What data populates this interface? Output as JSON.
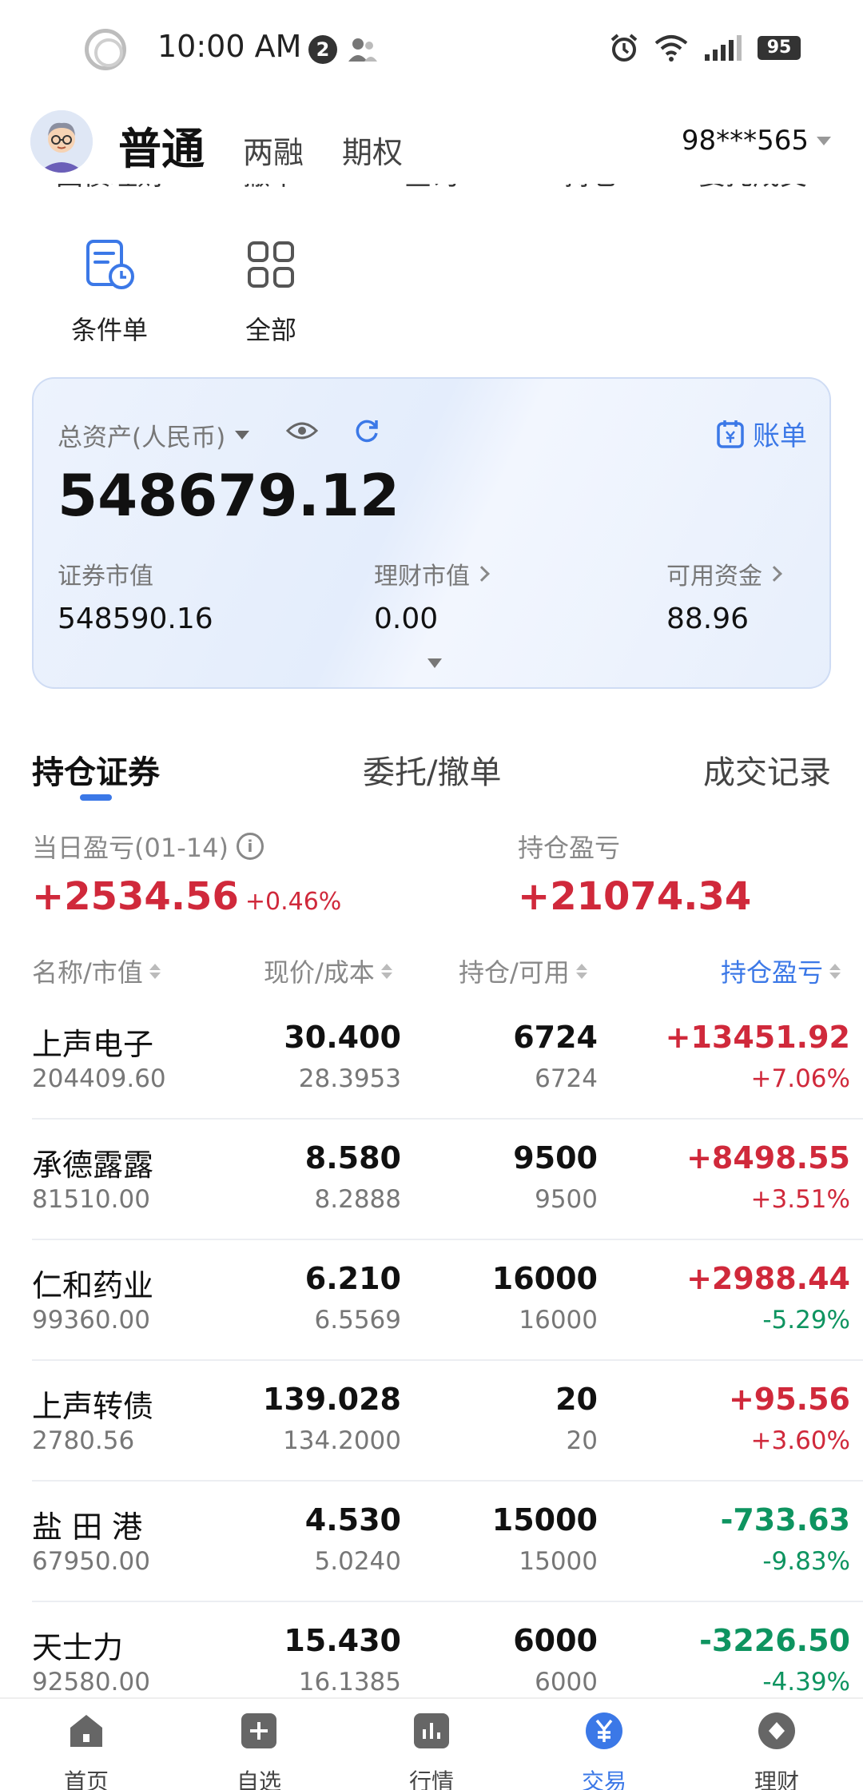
{
  "status_bar": {
    "time": "10:00 AM",
    "notification_count": "2",
    "battery": "95"
  },
  "header": {
    "account_tabs": [
      "普通",
      "两融",
      "期权"
    ],
    "account_id": "98***565"
  },
  "shortcuts_clipped": [
    "国债理财",
    "撤单",
    "查询",
    "持仓",
    "委托成交"
  ],
  "shortcuts": [
    {
      "label": "条件单",
      "icon": "conditional-order-icon"
    },
    {
      "label": "全部",
      "icon": "grid-icon"
    }
  ],
  "assets": {
    "title": "总资产(人民币)",
    "bill_label": "账单",
    "total": "548679.12",
    "sub": [
      {
        "label": "证券市值",
        "value": "548590.16"
      },
      {
        "label": "理财市值",
        "value": "0.00"
      },
      {
        "label": "可用资金",
        "value": "88.96"
      }
    ]
  },
  "tabs": [
    "持仓证券",
    "委托/撤单",
    "成交记录"
  ],
  "pnl": {
    "daily_label": "当日盈亏(01-14)",
    "daily_value": "+2534.56",
    "daily_pct": "+0.46%",
    "holding_label": "持仓盈亏",
    "holding_value": "+21074.34"
  },
  "table": {
    "headers": [
      "名称/市值",
      "现价/成本",
      "持仓/可用",
      "持仓盈亏"
    ],
    "rows": [
      {
        "name": "上声电子",
        "market_value": "204409.60",
        "price": "30.400",
        "cost": "28.3953",
        "qty": "6724",
        "avail": "6724",
        "pl": "+13451.92",
        "pl_pct": "+7.06%"
      },
      {
        "name": "承德露露",
        "market_value": "81510.00",
        "price": "8.580",
        "cost": "8.2888",
        "qty": "9500",
        "avail": "9500",
        "pl": "+8498.55",
        "pl_pct": "+3.51%"
      },
      {
        "name": "仁和药业",
        "market_value": "99360.00",
        "price": "6.210",
        "cost": "6.5569",
        "qty": "16000",
        "avail": "16000",
        "pl": "+2988.44",
        "pl_pct": "-5.29%"
      },
      {
        "name": "上声转债",
        "market_value": "2780.56",
        "price": "139.028",
        "cost": "134.2000",
        "qty": "20",
        "avail": "20",
        "pl": "+95.56",
        "pl_pct": "+3.60%"
      },
      {
        "name": "盐 田 港",
        "market_value": "67950.00",
        "price": "4.530",
        "cost": "5.0240",
        "qty": "15000",
        "avail": "15000",
        "pl": "-733.63",
        "pl_pct": "-9.83%"
      },
      {
        "name": "天士力",
        "market_value": "92580.00",
        "price": "15.430",
        "cost": "16.1385",
        "qty": "6000",
        "avail": "6000",
        "pl": "-3226.50",
        "pl_pct": "-4.39%"
      }
    ]
  },
  "bottom_nav": [
    {
      "label": "首页",
      "icon": "home-icon"
    },
    {
      "label": "自选",
      "icon": "watchlist-icon"
    },
    {
      "label": "行情",
      "icon": "market-icon"
    },
    {
      "label": "交易",
      "icon": "trade-yuan-icon"
    },
    {
      "label": "理财",
      "icon": "wealth-icon"
    }
  ],
  "colors": {
    "accent": "#3b78e7",
    "up": "#d0293b",
    "down": "#0e9460"
  }
}
